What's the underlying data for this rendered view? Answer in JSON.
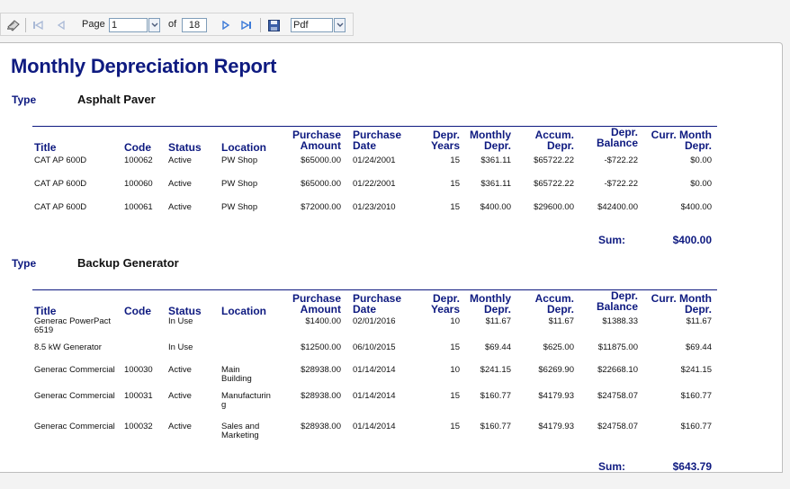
{
  "toolbar": {
    "page_label": "Page",
    "page_value": "1",
    "of_label": "of",
    "total_pages": "18",
    "format_value": "Pdf",
    "icons": [
      "print-icon",
      "first-page-icon",
      "prev-page-icon",
      "next-page-icon",
      "last-page-icon",
      "save-icon"
    ]
  },
  "report": {
    "title": "Monthly Depreciation Report",
    "type_label": "Type",
    "columns": {
      "title": "Title",
      "code": "Code",
      "status": "Status",
      "location": "Location",
      "purchase_amount": [
        "Purchase",
        "Amount"
      ],
      "purchase_date": [
        "Purchase",
        "Date"
      ],
      "depr_years": [
        "Depr.",
        "Years"
      ],
      "monthly_depr": [
        "Monthly",
        "Depr."
      ],
      "accum_depr": [
        "Accum.",
        "Depr."
      ],
      "depr_balance": [
        "Depr.",
        "Balance"
      ],
      "curr_month_depr": [
        "Curr. Month",
        "Depr."
      ]
    },
    "sum_label": "Sum:",
    "groups": [
      {
        "type": "Asphalt Paver",
        "sum": "$400.00",
        "rows": [
          {
            "title": [
              "CAT AP 600D"
            ],
            "code": "100062",
            "status": "Active",
            "location": [
              "PW Shop"
            ],
            "amount": "$65000.00",
            "date": "01/24/2001",
            "years": "15",
            "monthly": "$361.11",
            "accum": "$65722.22",
            "balance": "-$722.22",
            "curr": "$0.00"
          },
          {
            "title": [
              "CAT AP 600D"
            ],
            "code": "100060",
            "status": "Active",
            "location": [
              "PW Shop"
            ],
            "amount": "$65000.00",
            "date": "01/22/2001",
            "years": "15",
            "monthly": "$361.11",
            "accum": "$65722.22",
            "balance": "-$722.22",
            "curr": "$0.00"
          },
          {
            "title": [
              "CAT AP 600D"
            ],
            "code": "100061",
            "status": "Active",
            "location": [
              "PW Shop"
            ],
            "amount": "$72000.00",
            "date": "01/23/2010",
            "years": "15",
            "monthly": "$400.00",
            "accum": "$29600.00",
            "balance": "$42400.00",
            "curr": "$400.00"
          }
        ]
      },
      {
        "type": "Backup Generator",
        "sum": "$643.79",
        "rows": [
          {
            "title": [
              "Generac PowerPact",
              "6519"
            ],
            "code": "",
            "status": "In Use",
            "location": [
              ""
            ],
            "amount": "$1400.00",
            "date": "02/01/2016",
            "years": "10",
            "monthly": "$11.67",
            "accum": "$11.67",
            "balance": "$1388.33",
            "curr": "$11.67"
          },
          {
            "title": [
              "8.5 kW Generator"
            ],
            "code": "",
            "status": "In Use",
            "location": [
              ""
            ],
            "amount": "$12500.00",
            "date": "06/10/2015",
            "years": "15",
            "monthly": "$69.44",
            "accum": "$625.00",
            "balance": "$11875.00",
            "curr": "$69.44"
          },
          {
            "title": [
              "Generac Commercial"
            ],
            "code": "100030",
            "status": "Active",
            "location": [
              "Main",
              "Building"
            ],
            "amount": "$28938.00",
            "date": "01/14/2014",
            "years": "10",
            "monthly": "$241.15",
            "accum": "$6269.90",
            "balance": "$22668.10",
            "curr": "$241.15"
          },
          {
            "title": [
              "Generac Commercial"
            ],
            "code": "100031",
            "status": "Active",
            "location": [
              "Manufacturin",
              "g"
            ],
            "amount": "$28938.00",
            "date": "01/14/2014",
            "years": "15",
            "monthly": "$160.77",
            "accum": "$4179.93",
            "balance": "$24758.07",
            "curr": "$160.77"
          },
          {
            "title": [
              "Generac Commercial"
            ],
            "code": "100032",
            "status": "Active",
            "location": [
              "Sales and",
              "Marketing"
            ],
            "amount": "$28938.00",
            "date": "01/14/2014",
            "years": "15",
            "monthly": "$160.77",
            "accum": "$4179.93",
            "balance": "$24758.07",
            "curr": "$160.77"
          }
        ]
      }
    ]
  }
}
